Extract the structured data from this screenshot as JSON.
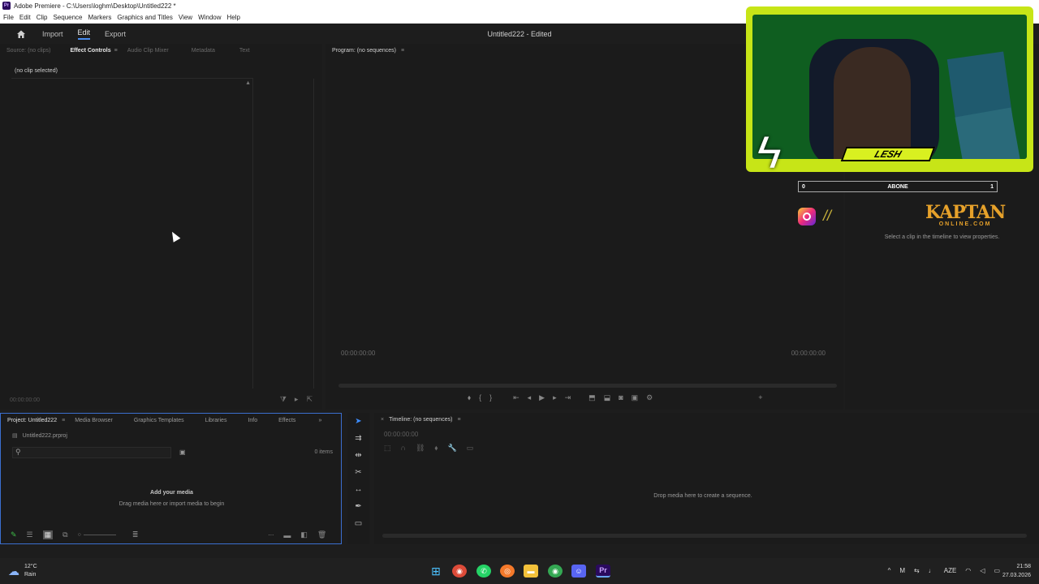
{
  "titlebar": {
    "title": "Adobe Premiere - C:\\Users\\loghm\\Desktop\\Untitled222 *",
    "logo_text": "Pr"
  },
  "menubar": {
    "items": [
      "File",
      "Edit",
      "Clip",
      "Sequence",
      "Markers",
      "Graphics and Titles",
      "View",
      "Window",
      "Help"
    ]
  },
  "header": {
    "tabs": [
      "Import",
      "Edit",
      "Export"
    ],
    "active_tab": "Edit",
    "project_title": "Untitled222 - Edited"
  },
  "left_panel": {
    "tabs": [
      "Source: (no clips)",
      "Effect Controls",
      "Audio Clip Mixer",
      "Metadata",
      "Text"
    ],
    "active_tab": "Effect Controls",
    "clip_status": "(no clip selected)",
    "timecode": "00:00:00:00"
  },
  "program_panel": {
    "title": "Program: (no sequences)",
    "timecode_left": "00:00:00:00",
    "timecode_right": "00:00:00:00"
  },
  "properties_panel": {
    "hint": "Select a clip in the timeline to view properties."
  },
  "project_panel": {
    "tabs": [
      "Project: Untitled222",
      "Media Browser",
      "Graphics Templates",
      "Libraries",
      "Info",
      "Effects"
    ],
    "file": "Untitled222.prproj",
    "item_count": "0 items",
    "empty_title": "Add your media",
    "empty_subtitle": "Drag media here or import media to begin"
  },
  "timeline_panel": {
    "title": "Timeline: (no sequences)",
    "timecode": "00:00:00:00",
    "drop_hint": "Drop media here to create a sequence."
  },
  "overlay": {
    "name_plate": "LESH",
    "subscribe_label": "ABONE",
    "subscribe_min": "0",
    "subscribe_max": "1",
    "brand_line1": "KAPTAN",
    "brand_line2": "ONLINE.COM"
  },
  "taskbar": {
    "temperature": "12°C",
    "weather": "Rain",
    "language": "AZE",
    "time": "21:58",
    "date": "27.03.2026"
  },
  "colors": {
    "accent": "#3d8dff",
    "panel_bg": "#1b1b1b",
    "overlay_green": "#c7e517",
    "brand_orange": "#e6a12a"
  }
}
